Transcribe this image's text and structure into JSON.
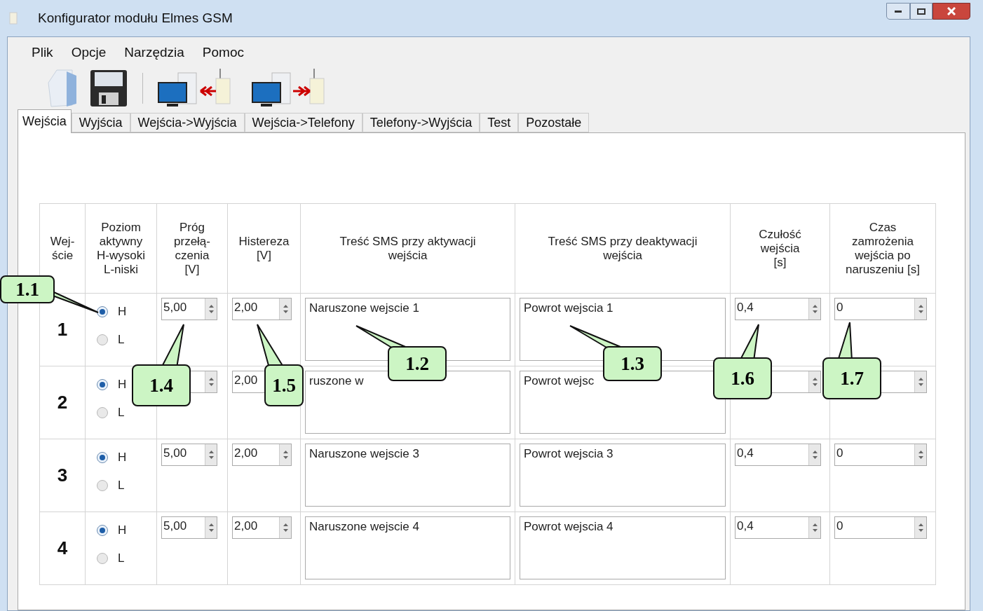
{
  "window": {
    "title": "Konfigurator modułu Elmes GSM"
  },
  "menu": [
    "Plik",
    "Opcje",
    "Narzędzia",
    "Pomoc"
  ],
  "tabs": [
    {
      "label": "Wejścia",
      "selected": true
    },
    {
      "label": "Wyjścia",
      "selected": false
    },
    {
      "label": "Wejścia->Wyjścia",
      "selected": false
    },
    {
      "label": "Wejścia->Telefony",
      "selected": false
    },
    {
      "label": "Telefony->Wyjścia",
      "selected": false
    },
    {
      "label": "Test",
      "selected": false
    },
    {
      "label": "Pozostałe",
      "selected": false
    }
  ],
  "table": {
    "columns": [
      "Wej-\nście",
      "Poziom\naktywny\nH-wysoki\nL-niski",
      "Próg\nprzełą-\nczenia\n[V]",
      "Histereza\n[V]",
      "Treść SMS przy aktywacji\nwejścia",
      "Treść SMS przy deaktywacji\nwejścia",
      "Czułość\nwejścia\n[s]",
      "Czas\nzamrożenia\nwejścia po\nnaruszeniu [s]"
    ],
    "rows": [
      {
        "number": "1",
        "levels": [
          {
            "label": "H",
            "selected": true
          },
          {
            "label": "L",
            "selected": false
          }
        ],
        "threshold": "5,00",
        "hysteresis": "2,00",
        "sms_on": "Naruszone wejscie 1",
        "sms_off": "Powrot wejscia 1",
        "sensitivity": "0,4",
        "freeze": "0"
      },
      {
        "number": "2",
        "levels": [
          {
            "label": "H",
            "selected": true
          },
          {
            "label": "L",
            "selected": false
          }
        ],
        "hysteresis": "2,00",
        "sms_on": "ruszone w",
        "sms_off": "Powrot wejsc"
      },
      {
        "number": "3",
        "levels": [
          {
            "label": "H",
            "selected": true
          },
          {
            "label": "L",
            "selected": false
          }
        ],
        "threshold": "5,00",
        "hysteresis": "2,00",
        "sms_on": "Naruszone wejscie 3",
        "sms_off": "Powrot wejscia 3",
        "sensitivity": "0,4",
        "freeze": "0"
      },
      {
        "number": "4",
        "levels": [
          {
            "label": "H",
            "selected": true
          },
          {
            "label": "L",
            "selected": false
          }
        ],
        "threshold": "5,00",
        "hysteresis": "2,00",
        "sms_on": "Naruszone wejscie 4",
        "sms_off": "Powrot wejscia 4",
        "sensitivity": "0,4",
        "freeze": "0"
      }
    ]
  },
  "callouts": [
    "1.1",
    "1.2",
    "1.3",
    "1.4",
    "1.5",
    "1.6",
    "1.7"
  ]
}
